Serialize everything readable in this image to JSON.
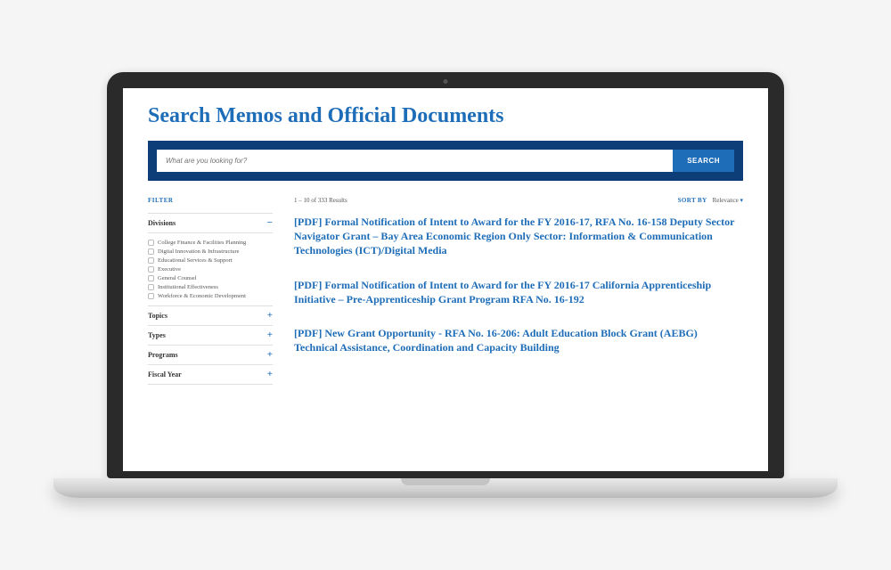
{
  "page": {
    "title": "Search Memos and Official Documents"
  },
  "search": {
    "placeholder": "What are you looking for?",
    "button_label": "SEARCH"
  },
  "sidebar": {
    "filter_label": "FILTER",
    "groups": [
      {
        "label": "Divisions",
        "expanded": true,
        "toggle_icon": "−",
        "options": [
          "College Finance & Facilities Planning",
          "Digital Innovation & Infrastructure",
          "Educational Services & Support",
          "Executive",
          "General Counsel",
          "Institutional Effectiveness",
          "Workforce & Economic Development"
        ]
      },
      {
        "label": "Topics",
        "expanded": false,
        "toggle_icon": "+"
      },
      {
        "label": "Types",
        "expanded": false,
        "toggle_icon": "+"
      },
      {
        "label": "Programs",
        "expanded": false,
        "toggle_icon": "+"
      },
      {
        "label": "Fiscal Year",
        "expanded": false,
        "toggle_icon": "+"
      }
    ]
  },
  "results": {
    "count_text": "1 – 10 of 333 Results",
    "sort_by_label": "SORT BY",
    "sort_value": "Relevance",
    "items": [
      {
        "title": "[PDF] Formal Notification of Intent to Award for the FY 2016-17, RFA No. 16-158 Deputy Sector Navigator Grant – Bay Area Economic Region Only Sector: Information & Communication Technologies (ICT)/Digital Media"
      },
      {
        "title": "[PDF] Formal Notification of Intent to Award for the FY 2016-17 California Apprenticeship Initiative – Pre-Apprenticeship Grant Program RFA No. 16-192"
      },
      {
        "title": "[PDF] New Grant Opportunity - RFA No. 16-206: Adult Education Block Grant (AEBG) Technical Assistance, Coordination and Capacity Building"
      }
    ]
  }
}
